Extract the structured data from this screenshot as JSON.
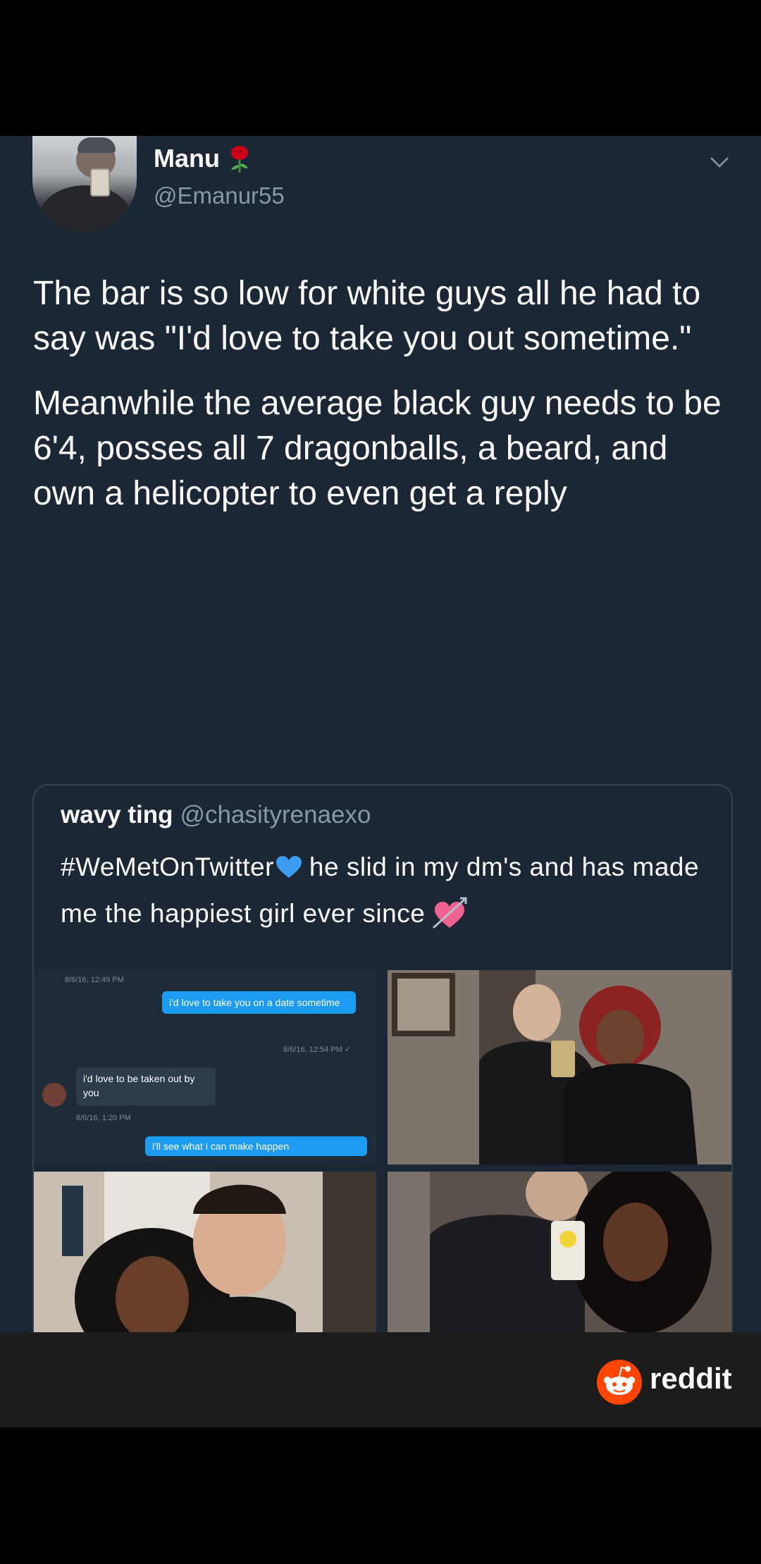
{
  "tweet": {
    "name": "Manu",
    "handle": "@Emanur55",
    "name_emoji": "rose-icon",
    "paragraphs": [
      "The bar is so low for white guys all he had to say was \"I'd love to take you out sometime.\"",
      "Meanwhile the average black guy needs to be 6'4, posses all 7 dragonballs, a beard, and own a helicopter to even get a reply"
    ]
  },
  "quote": {
    "name": "wavy ting",
    "handle": "@chasityrenaexo",
    "hashtag": "#WeMetOnTwitter",
    "text": "he slid in my dm's and has made me the happiest girl ever since",
    "dm": {
      "ts1": "8/6/16, 12:49 PM",
      "msg1": "i'd love to take you on a date sometime",
      "ts2": "8/6/16, 12:54 PM ✓",
      "msg2": "i'd love to be taken out by you",
      "ts3": "8/6/16, 1:20 PM",
      "msg3": "i'll see what i can make happen"
    }
  },
  "footer": {
    "brand": "reddit"
  },
  "colors": {
    "background": "#1b2735",
    "secondary_text": "#8899a6",
    "accent_blue": "#1d9bf0",
    "reddit_orange": "#ff4500"
  }
}
